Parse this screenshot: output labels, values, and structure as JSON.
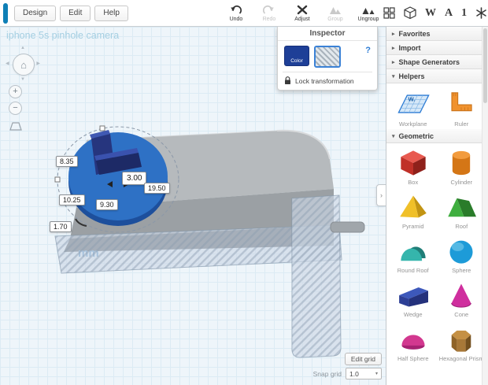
{
  "header": {
    "menus": [
      {
        "label": "Design"
      },
      {
        "label": "Edit"
      },
      {
        "label": "Help"
      }
    ],
    "tools": [
      {
        "label": "Undo",
        "enabled": true
      },
      {
        "label": "Redo",
        "enabled": false
      },
      {
        "label": "Adjust",
        "enabled": true
      },
      {
        "label": "Group",
        "enabled": false
      },
      {
        "label": "Ungroup",
        "enabled": true
      }
    ],
    "right_icons": {
      "w": "W",
      "a": "A",
      "one": "1"
    }
  },
  "canvas": {
    "title": "iphone 5s pinhole camera",
    "unit_label": "mm",
    "dim_labels": [
      "8.35",
      "3.00",
      "19.50",
      "10.25",
      "9.30",
      "1.70"
    ],
    "grid": {
      "edit_button": "Edit grid",
      "snap_label": "Snap grid",
      "snap_value": "1.0",
      "caret": "▾"
    },
    "nav": {
      "home_glyph": "⌂",
      "zoom_in": "+",
      "zoom_out": "−",
      "arrows": {
        "up": "▲",
        "down": "▼",
        "left": "◀",
        "right": "▶"
      }
    }
  },
  "inspector": {
    "title": "Inspector",
    "color_label": "Color",
    "help_glyph": "?",
    "lock_label": "Lock transformation"
  },
  "sidebar": {
    "collapse_glyph": "›",
    "chevron_expanded": "▾",
    "chevron_collapsed": "▸",
    "workplane_mark": "W.",
    "sections": [
      {
        "label": "Favorites",
        "expanded": false
      },
      {
        "label": "Import",
        "expanded": false
      },
      {
        "label": "Shape Generators",
        "expanded": false
      },
      {
        "label": "Helpers",
        "expanded": true,
        "items": [
          {
            "label": "Workplane"
          },
          {
            "label": "Ruler"
          }
        ]
      },
      {
        "label": "Geometric",
        "expanded": true,
        "items": [
          {
            "label": "Box"
          },
          {
            "label": "Cylinder"
          },
          {
            "label": "Pyramid"
          },
          {
            "label": "Roof"
          },
          {
            "label": "Round Roof"
          },
          {
            "label": "Sphere"
          },
          {
            "label": "Wedge"
          },
          {
            "label": "Cone"
          },
          {
            "label": "Half Sphere"
          },
          {
            "label": "Hexagonal Prism"
          }
        ]
      }
    ]
  },
  "colors": {
    "accent_blue": "#2b7bd4",
    "selection_blue": "#2e71c5",
    "workplane_bg": "#eef5fa",
    "grid_line": "#dcebf4",
    "shape_red": "#c03028",
    "shape_orange": "#d47616",
    "shape_yellow": "#f0c029",
    "shape_green": "#3fae3f",
    "shape_teal": "#35b5ac",
    "shape_blue": "#1d9bd8",
    "shape_navy": "#24317c",
    "shape_magenta": "#cf2f9e",
    "shape_pink": "#d2388f",
    "shape_brown": "#a87838"
  }
}
